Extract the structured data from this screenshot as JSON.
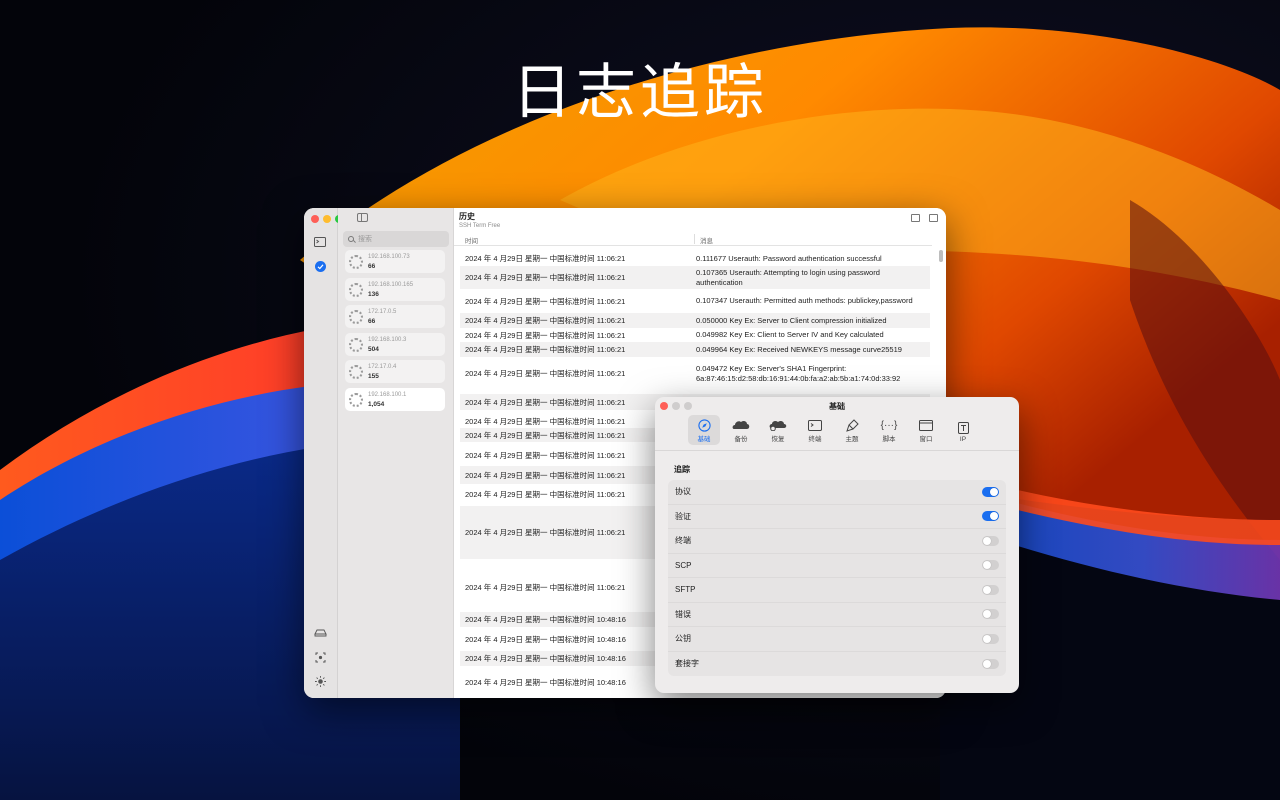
{
  "hero": {
    "title": "日志追踪"
  },
  "sidebar": {
    "search_placeholder": "搜索",
    "servers": [
      {
        "ip": "192.168.100.73",
        "count": "66"
      },
      {
        "ip": "192.168.100.165",
        "count": "136"
      },
      {
        "ip": "172.17.0.5",
        "count": "66"
      },
      {
        "ip": "192.168.100.3",
        "count": "504"
      },
      {
        "ip": "172.17.0.4",
        "count": "155"
      },
      {
        "ip": "192.168.100.1",
        "count": "1,054"
      }
    ]
  },
  "history": {
    "title": "历史",
    "subtitle": "SSH Term Free",
    "col_time": "时间",
    "col_message": "消息",
    "rows": [
      {
        "time": "2024 年 4 月29日 星期一 中国标准时间 11:06:21",
        "msg": "0.111677 Userauth: Password authentication successful"
      },
      {
        "time": "2024 年 4 月29日 星期一 中国标准时间 11:06:21",
        "msg": "0.107365 Userauth: Attempting to login using password authentication"
      },
      {
        "time": "2024 年 4 月29日 星期一 中国标准时间 11:06:21",
        "msg": "0.107347 Userauth: Permitted auth methods: publickey,password"
      },
      {
        "time": "2024 年 4 月29日 星期一 中国标准时间 11:06:21",
        "msg": "0.050000 Key Ex: Server to Client compression initialized"
      },
      {
        "time": "2024 年 4 月29日 星期一 中国标准时间 11:06:21",
        "msg": "0.049982 Key Ex: Client to Server IV and Key calculated"
      },
      {
        "time": "2024 年 4 月29日 星期一 中国标准时间 11:06:21",
        "msg": "0.049964 Key Ex: Received NEWKEYS message curve25519"
      },
      {
        "time": "2024 年 4 月29日 星期一 中国标准时间 11:06:21",
        "msg": "0.049472 Key Ex: Server's SHA1 Fingerprint: 6a:87:46:15:d2:58:db:16:91:44:0b:fa:a2:ab:5b:a1:74:0d:33:92"
      },
      {
        "time": "2024 年 4 月29日 星期一 中国标准时间 11:06:21",
        "msg": ""
      },
      {
        "time": "2024 年 4 月29日 星期一 中国标准时间 11:06:21",
        "msg": ""
      },
      {
        "time": "2024 年 4 月29日 星期一 中国标准时间 11:06:21",
        "msg": ""
      },
      {
        "time": "2024 年 4 月29日 星期一 中国标准时间 11:06:21",
        "msg": ""
      },
      {
        "time": "2024 年 4 月29日 星期一 中国标准时间 11:06:21",
        "msg": ""
      },
      {
        "time": "2024 年 4 月29日 星期一 中国标准时间 11:06:21",
        "msg": ""
      },
      {
        "time": "2024 年 4 月29日 星期一 中国标准时间 11:06:21",
        "msg": ""
      },
      {
        "time": "2024 年 4 月29日 星期一 中国标准时间 11:06:21",
        "msg": ""
      },
      {
        "time": "2024 年 4 月29日 星期一 中国标准时间 10:48:16",
        "msg": ""
      },
      {
        "time": "2024 年 4 月29日 星期一 中国标准时间 10:48:16",
        "msg": ""
      },
      {
        "time": "2024 年 4 月29日 星期一 中国标准时间 10:48:16",
        "msg": ""
      },
      {
        "time": "2024 年 4 月29日 星期一 中国标准时间 10:48:16",
        "msg": ""
      }
    ]
  },
  "settings": {
    "title": "基础",
    "tabs": [
      {
        "label": "基础",
        "icon": "compass-icon"
      },
      {
        "label": "备份",
        "icon": "cloud-backup-icon"
      },
      {
        "label": "恢复",
        "icon": "restore-icon"
      },
      {
        "label": "终端",
        "icon": "terminal-icon"
      },
      {
        "label": "主题",
        "icon": "brush-icon"
      },
      {
        "label": "脚本",
        "icon": "braces-icon"
      },
      {
        "label": "窗口",
        "icon": "window-icon"
      },
      {
        "label": "IP",
        "icon": "text-box-icon"
      }
    ],
    "section": "追踪",
    "toggles": [
      {
        "label": "协议",
        "on": true
      },
      {
        "label": "验证",
        "on": true
      },
      {
        "label": "终端",
        "on": false
      },
      {
        "label": "SCP",
        "on": false
      },
      {
        "label": "SFTP",
        "on": false
      },
      {
        "label": "错误",
        "on": false
      },
      {
        "label": "公钥",
        "on": false
      },
      {
        "label": "套接字",
        "on": false
      }
    ]
  },
  "colors": {
    "accent": "#1a6ef0",
    "toggle_off": "#d2d0d0"
  }
}
